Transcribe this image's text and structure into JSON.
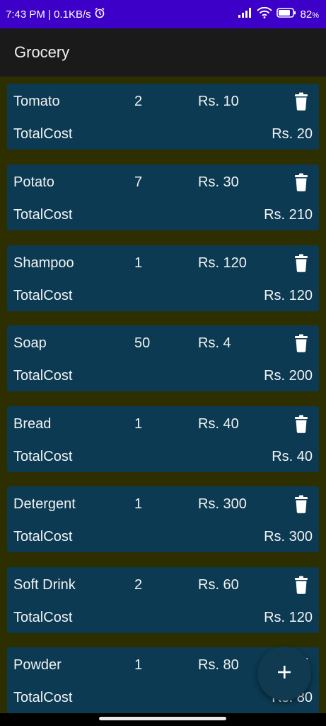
{
  "status_bar": {
    "time_speed": "7:43 PM | 0.1KB/s",
    "battery": "82"
  },
  "app_bar": {
    "title": "Grocery"
  },
  "items": [
    {
      "name": "Tomato",
      "qty": "2",
      "price": "Rs. 10",
      "total_label": "TotalCost",
      "total": "Rs. 20"
    },
    {
      "name": "Potato",
      "qty": "7",
      "price": "Rs. 30",
      "total_label": "TotalCost",
      "total": "Rs. 210"
    },
    {
      "name": "Shampoo",
      "qty": "1",
      "price": "Rs. 120",
      "total_label": "TotalCost",
      "total": "Rs. 120"
    },
    {
      "name": "Soap",
      "qty": "50",
      "price": "Rs. 4",
      "total_label": "TotalCost",
      "total": "Rs. 200"
    },
    {
      "name": "Bread",
      "qty": "1",
      "price": "Rs. 40",
      "total_label": "TotalCost",
      "total": "Rs. 40"
    },
    {
      "name": "Detergent",
      "qty": "1",
      "price": "Rs. 300",
      "total_label": "TotalCost",
      "total": "Rs. 300"
    },
    {
      "name": "Soft Drink",
      "qty": "2",
      "price": "Rs. 60",
      "total_label": "TotalCost",
      "total": "Rs. 120"
    },
    {
      "name": "Powder",
      "qty": "1",
      "price": "Rs. 80",
      "total_label": "TotalCost",
      "total": "Rs. 80"
    }
  ],
  "icons": {
    "delete": "trash-icon",
    "add": "plus-icon",
    "alarm": "alarm-icon",
    "signal": "signal-icon",
    "wifi": "wifi-icon",
    "battery": "battery-icon"
  }
}
